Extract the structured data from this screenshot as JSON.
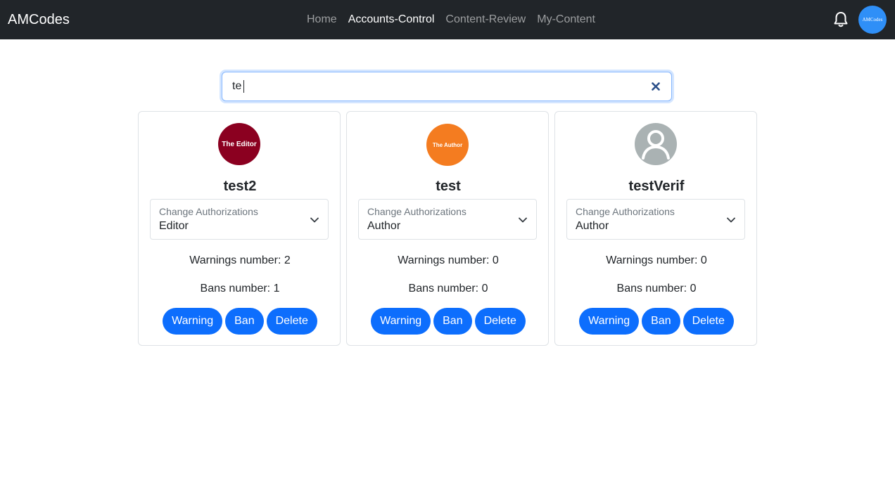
{
  "navbar": {
    "brand": "AMCodes",
    "links": [
      {
        "label": "Home",
        "active": false
      },
      {
        "label": "Accounts-Control",
        "active": true
      },
      {
        "label": "Content-Review",
        "active": false
      },
      {
        "label": "My-Content",
        "active": false
      }
    ],
    "bell_icon": "bell-icon",
    "avatar_text": "AMCodes"
  },
  "search": {
    "value": "te",
    "clear_icon": "close-icon"
  },
  "cards": [
    {
      "avatar_text": "The Editor",
      "username": "test2",
      "select_label": "Change Authorizations",
      "select_value": "Editor",
      "warnings": "Warnings number: 2",
      "bans": "Bans number: 1",
      "buttons": {
        "warning": "Warning",
        "ban": "Ban",
        "delete": "Delete"
      }
    },
    {
      "avatar_text": "The Author",
      "username": "test",
      "select_label": "Change Authorizations",
      "select_value": "Author",
      "warnings": "Warnings number: 0",
      "bans": "Bans number: 0",
      "buttons": {
        "warning": "Warning",
        "ban": "Ban",
        "delete": "Delete"
      }
    },
    {
      "avatar_text": "",
      "username": "testVerif",
      "select_label": "Change Authorizations",
      "select_value": "Author",
      "warnings": "Warnings number: 0",
      "bans": "Bans number: 0",
      "buttons": {
        "warning": "Warning",
        "ban": "Ban",
        "delete": "Delete"
      }
    }
  ],
  "colors": {
    "navbar_bg": "#212529",
    "primary": "#0d6efd",
    "editor_avatar": "#8b0020",
    "author_avatar": "#f47c20",
    "default_avatar": "#aab2b3"
  }
}
